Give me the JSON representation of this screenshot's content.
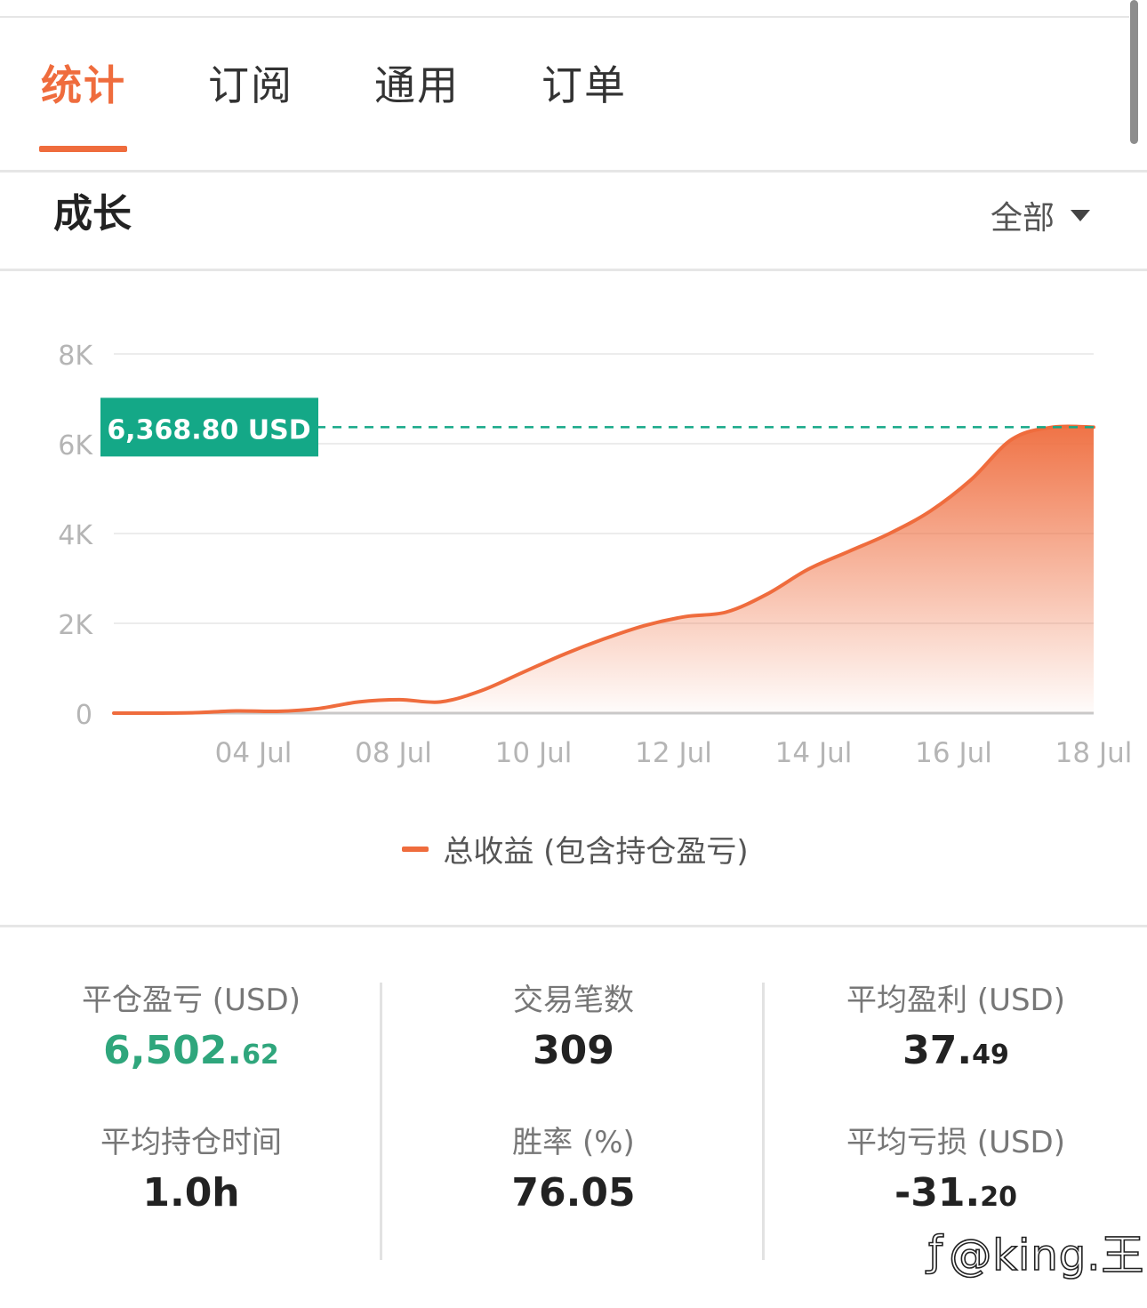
{
  "tabs": [
    {
      "label": "统计",
      "active": true
    },
    {
      "label": "订阅",
      "active": false
    },
    {
      "label": "通用",
      "active": false
    },
    {
      "label": "订单",
      "active": false
    }
  ],
  "section": {
    "title": "成长",
    "range_label": "全部"
  },
  "chart_data": {
    "type": "area",
    "x_tick_labels": [
      "04 Jul",
      "08 Jul",
      "10 Jul",
      "12 Jul",
      "14 Jul",
      "16 Jul",
      "18 Jul"
    ],
    "y_tick_labels": [
      "0",
      "2K",
      "4K",
      "6K",
      "8K"
    ],
    "ylim": [
      0,
      8000
    ],
    "grid": true,
    "series": [
      {
        "name": "总收益 (包含持仓盈亏)",
        "color": "#ef6c3d",
        "values": [
          0,
          0,
          10,
          50,
          40,
          100,
          250,
          300,
          250,
          500,
          900,
          1300,
          1650,
          1950,
          2150,
          2250,
          2650,
          3200,
          3600,
          4000,
          4500,
          5200,
          6100,
          6368.8,
          6368.8
        ]
      }
    ],
    "current_value_label": "6,368.80 USD",
    "current_value": 6368.8,
    "legend_position": "bottom"
  },
  "stats": [
    {
      "label": "平仓盈亏 (USD)",
      "int": "6,502.",
      "frac": "62",
      "positive": true
    },
    {
      "label": "交易笔数",
      "int": "309",
      "frac": ""
    },
    {
      "label": "平均盈利 (USD)",
      "int": "37.",
      "frac": "49"
    },
    {
      "label": "平均持仓时间",
      "int": "1.0h",
      "frac": ""
    },
    {
      "label": "胜率 (%)",
      "int": "76.05",
      "frac": ""
    },
    {
      "label": "平均亏损 (USD)",
      "int": "-31.",
      "frac": "20"
    }
  ],
  "colors": {
    "accent": "#ef6c3d",
    "positive": "#2fa67c",
    "marker": "#14a887"
  },
  "watermark": {
    "icon": "zhihu-icon",
    "text": "@king.王"
  }
}
